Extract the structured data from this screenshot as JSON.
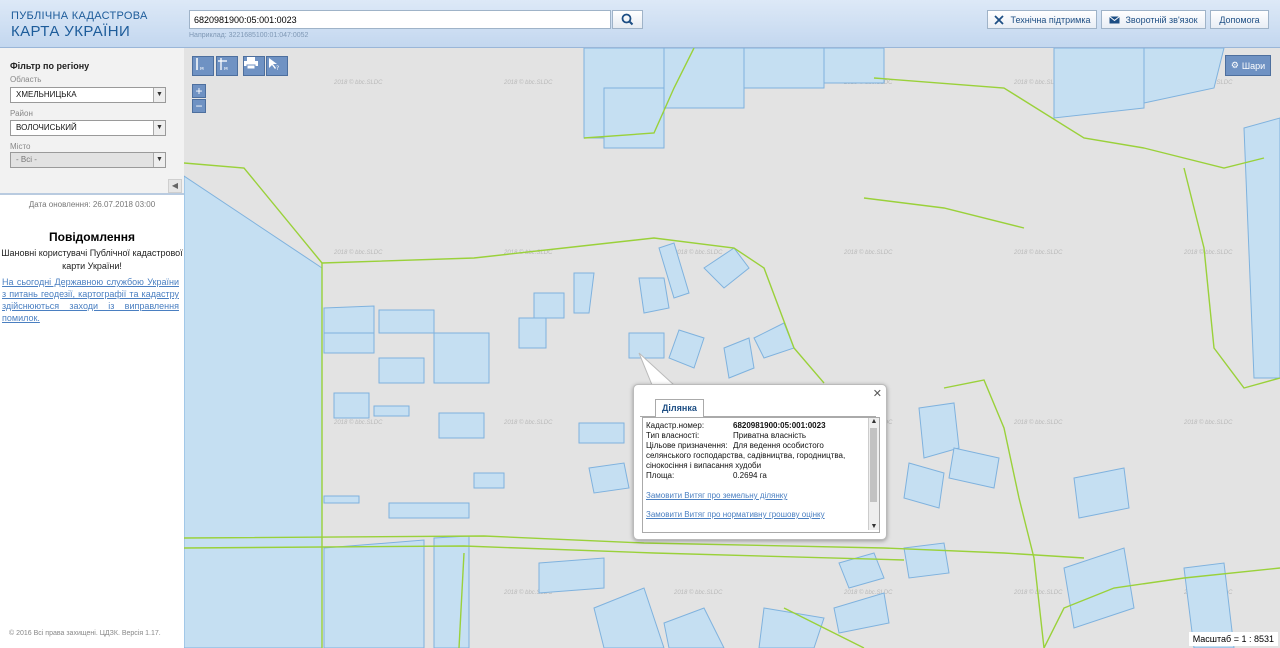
{
  "header": {
    "brand_line1": "ПУБЛІЧНА КАДАСТРОВА",
    "brand_line2": "КАРТА УКРАЇНИ",
    "search_value": "6820981900:05:001:0023",
    "search_example": "Наприклад: 3221685100:01:047:0052",
    "buttons": {
      "support": "Технічна підтримка",
      "feedback": "Зворотній зв'язок",
      "help": "Допомога"
    }
  },
  "sidebar": {
    "filter_title": "Фільтр по регіону",
    "region_label": "Область",
    "region_value": "ХМЕЛЬНИЦЬКА",
    "district_label": "Район",
    "district_value": "ВОЛОЧИСЬКИЙ",
    "city_label": "Місто",
    "city_value": "- Всі -",
    "updated": "Дата оновлення: 26.07.2018 03:00",
    "notice_title": "Повідомлення",
    "notice_body": "Шановні користувачі Публічної кадастрової карти України!",
    "notice_link": "На сьогодні Державною службою України з питань геодезії, картографії та кадастру здійснюються заходи із виправлення помилок.",
    "copyright": "© 2016 Всі права захищені. ЦДЗК. Версія 1.17."
  },
  "map": {
    "layers_label": "Шари",
    "scale_text": "Масштаб = 1 : 8531",
    "watermark": "2018 © bbc.SLDC",
    "colors": {
      "parcel_fill": "#c5dff2",
      "parcel_stroke": "#7fb2de",
      "boundary": "#9ad13a",
      "background": "#e3e3e3"
    },
    "tools": [
      "ruler-line",
      "ruler-area",
      "print",
      "identify"
    ]
  },
  "popup": {
    "tab": "Ділянка",
    "rows": [
      {
        "label": "Кадастр.номер:",
        "value": "6820981900:05:001:0023"
      },
      {
        "label": "Тип власності:",
        "value": "Приватна власність"
      },
      {
        "label": "Цільове призначення:",
        "value": "Для ведення особистого"
      }
    ],
    "purpose_cont1": "селянського господарства, садівництва, городництва,",
    "purpose_cont2": "сінокосіння і випасання худоби",
    "area_label": "Площа:",
    "area_value": "0.2694 га",
    "link_extract": "Замовити Витяг про земельну ділянку",
    "link_valuation": "Замовити Витяг про нормативну грошову оцінку"
  }
}
